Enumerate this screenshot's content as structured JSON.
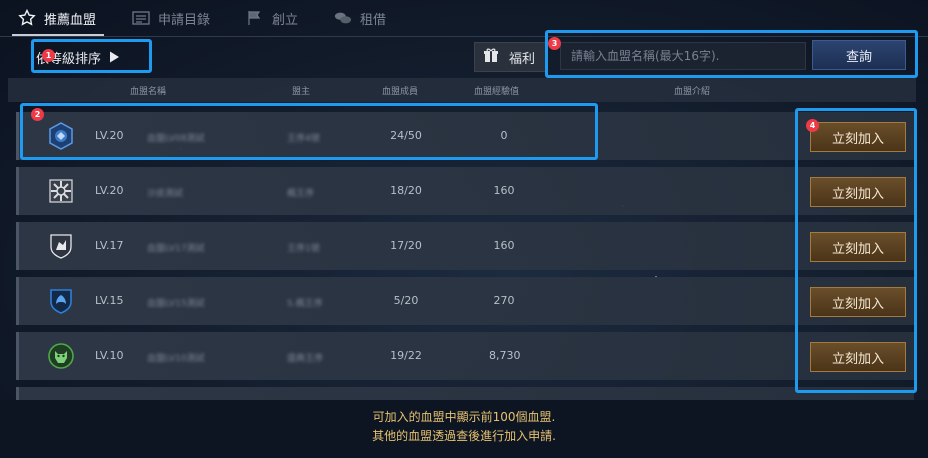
{
  "tabs": [
    {
      "label": "推薦血盟",
      "icon": "star-icon",
      "active": true
    },
    {
      "label": "申請目錄",
      "icon": "list-icon",
      "active": false
    },
    {
      "label": "創立",
      "icon": "flag-icon",
      "active": false
    },
    {
      "label": "租借",
      "icon": "coins-icon",
      "active": false
    }
  ],
  "sort": {
    "label": "依等級排序"
  },
  "welfare": {
    "label": "福利"
  },
  "search": {
    "placeholder": "請輸入血盟名稱(最大16字).",
    "button": "查詢"
  },
  "columns": {
    "name": "血盟名稱",
    "leader": "盟主",
    "members": "血盟成員",
    "exp": "血盟經驗值",
    "intro": "血盟介紹"
  },
  "rows": [
    {
      "level": "LV.20",
      "name": "血盟LV08測試",
      "leader": "王序4號",
      "members": "24/50",
      "exp": "0",
      "join": "立刻加入",
      "emblem_color": "#3d7cc9"
    },
    {
      "level": "LV.20",
      "name": "沙皮測試",
      "leader": "楓王序",
      "members": "18/20",
      "exp": "160",
      "join": "立刻加入",
      "emblem_color": "#d9dde3"
    },
    {
      "level": "LV.17",
      "name": "血盟LV17測試",
      "leader": "王序1號",
      "members": "17/20",
      "exp": "160",
      "join": "立刻加入",
      "emblem_color": "#e6e8ec"
    },
    {
      "level": "LV.15",
      "name": "血盟LV15測試",
      "leader": "S.楓王序",
      "members": "5/20",
      "exp": "270",
      "join": "立刻加入",
      "emblem_color": "#2f7fd8"
    },
    {
      "level": "LV.10",
      "name": "血盟LV10測試",
      "leader": "盛典王序",
      "members": "19/22",
      "exp": "8,730",
      "join": "立刻加入",
      "emblem_color": "#4fa84a"
    }
  ],
  "annotations": [
    "1",
    "2",
    "3",
    "4"
  ],
  "footer": {
    "line1": "可加入的血盟中顯示前100個血盟.",
    "line2": "其他的血盟透過查後進行加入申請."
  },
  "colors": {
    "accent_blue": "#1e9bf0",
    "badge_red": "#ee3a46",
    "join_gold": "#a47a3e",
    "footer_text": "#e6c170"
  }
}
